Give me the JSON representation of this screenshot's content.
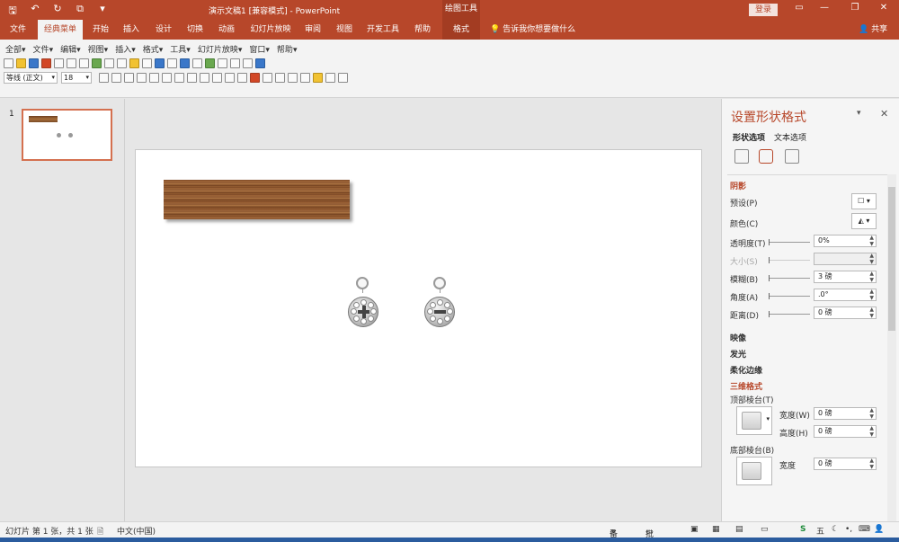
{
  "window": {
    "doc_title": "演示文稿1 [兼容模式] - PowerPoint",
    "context_group": "绘图工具",
    "login_label": "登录"
  },
  "tabs": {
    "items": [
      "文件",
      "经典菜单",
      "开始",
      "插入",
      "设计",
      "切换",
      "动画",
      "幻灯片放映",
      "审阅",
      "视图",
      "开发工具",
      "帮助",
      "格式"
    ],
    "active": "经典菜单",
    "tell_me": "告诉我你想要做什么",
    "share": "共享"
  },
  "ribbon": {
    "menus": [
      "全部",
      "文件",
      "编辑",
      "视图",
      "插入",
      "格式",
      "工具",
      "幻灯片放映",
      "窗口",
      "帮助"
    ],
    "font_name": "等线 (正文)",
    "font_size": "18"
  },
  "thumbnails": {
    "slide_number": "1"
  },
  "format_pane": {
    "title": "设置形状格式",
    "subtabs": [
      "形状选项",
      "文本选项"
    ],
    "sections": {
      "shadow": "阴影",
      "reflection": "映像",
      "glow": "发光",
      "soft_edges": "柔化边缘",
      "three_d_format": "三维格式"
    },
    "shadow": {
      "preset_label": "预设(P)",
      "color_label": "颜色(C)",
      "transparency_label": "透明度(T)",
      "transparency_value": "0%",
      "size_label": "大小(S)",
      "blur_label": "模糊(B)",
      "blur_value": "3 磅",
      "angle_label": "角度(A)",
      "angle_value": ".0°",
      "distance_label": "距离(D)",
      "distance_value": "0 磅"
    },
    "three_d": {
      "top_bevel_label": "顶部棱台(T)",
      "width_label": "宽度(W)",
      "width_value": "0 磅",
      "height_label": "高度(H)",
      "height_value": "0 磅",
      "bottom_bevel_label": "底部棱台(B)",
      "bottom_width_label": "宽度",
      "bottom_width_value": "0 磅"
    }
  },
  "statusbar": {
    "slide_info": "幻灯片 第 1 张，共 1 张",
    "language": "中文(中国)",
    "notes": "备注",
    "comments": "批注",
    "ime": "五"
  },
  "colors": {
    "accent": "#b7472a",
    "ribbon_bg": "#f3f3f3",
    "workspace_bg": "#e6e6e6"
  }
}
